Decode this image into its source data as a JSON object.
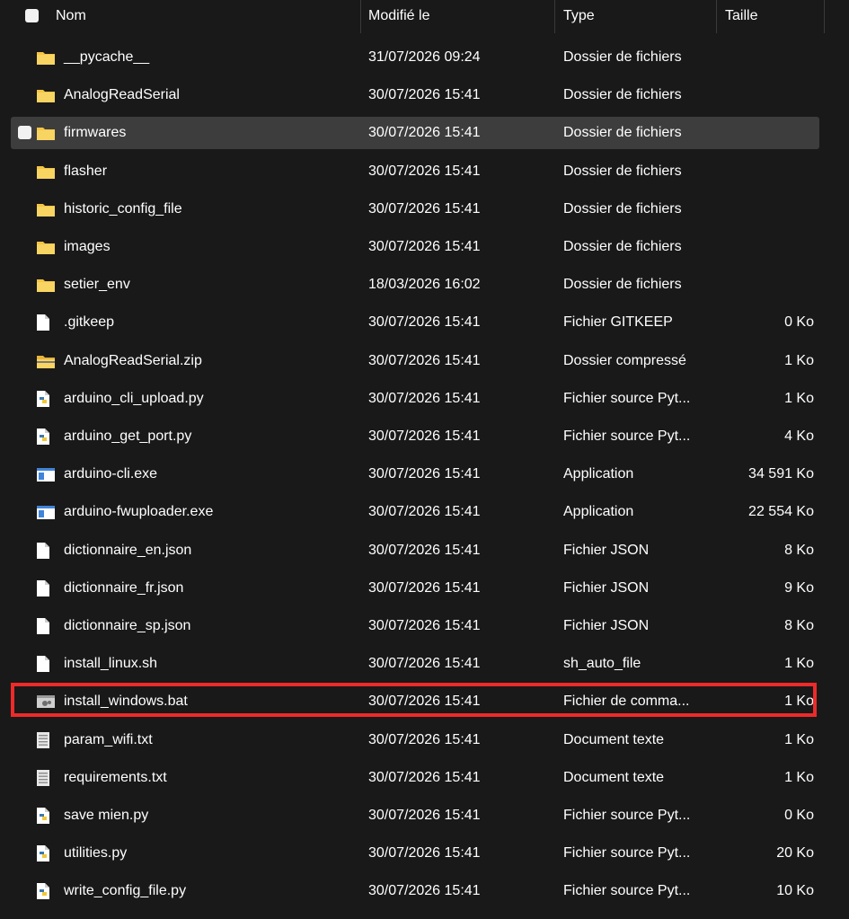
{
  "columns": {
    "name": "Nom",
    "date": "Modifié le",
    "type": "Type",
    "size": "Taille"
  },
  "files": [
    {
      "name": "__pycache__",
      "date": "31/07/2026 09:24",
      "type": "Dossier de fichiers",
      "size": "",
      "icon": "folder-icon"
    },
    {
      "name": "AnalogReadSerial",
      "date": "30/07/2026 15:41",
      "type": "Dossier de fichiers",
      "size": "",
      "icon": "folder-icon"
    },
    {
      "name": "firmwares",
      "date": "30/07/2026 15:41",
      "type": "Dossier de fichiers",
      "size": "",
      "icon": "folder-icon"
    },
    {
      "name": "flasher",
      "date": "30/07/2026 15:41",
      "type": "Dossier de fichiers",
      "size": "",
      "icon": "folder-icon"
    },
    {
      "name": "historic_config_file",
      "date": "30/07/2026 15:41",
      "type": "Dossier de fichiers",
      "size": "",
      "icon": "folder-icon"
    },
    {
      "name": "images",
      "date": "30/07/2026 15:41",
      "type": "Dossier de fichiers",
      "size": "",
      "icon": "folder-icon"
    },
    {
      "name": "setier_env",
      "date": "18/03/2026 16:02",
      "type": "Dossier de fichiers",
      "size": "",
      "icon": "folder-icon"
    },
    {
      "name": ".gitkeep",
      "date": "30/07/2026 15:41",
      "type": "Fichier GITKEEP",
      "size": "0 Ko",
      "icon": "file-icon"
    },
    {
      "name": "AnalogReadSerial.zip",
      "date": "30/07/2026 15:41",
      "type": "Dossier compressé",
      "size": "1 Ko",
      "icon": "zip-folder-icon"
    },
    {
      "name": "arduino_cli_upload.py",
      "date": "30/07/2026 15:41",
      "type": "Fichier source Pyt...",
      "size": "1 Ko",
      "icon": "python-file-icon"
    },
    {
      "name": "arduino_get_port.py",
      "date": "30/07/2026 15:41",
      "type": "Fichier source Pyt...",
      "size": "4 Ko",
      "icon": "python-file-icon"
    },
    {
      "name": "arduino-cli.exe",
      "date": "30/07/2026 15:41",
      "type": "Application",
      "size": "34 591 Ko",
      "icon": "application-icon"
    },
    {
      "name": "arduino-fwuploader.exe",
      "date": "30/07/2026 15:41",
      "type": "Application",
      "size": "22 554 Ko",
      "icon": "application-icon"
    },
    {
      "name": "dictionnaire_en.json",
      "date": "30/07/2026 15:41",
      "type": "Fichier JSON",
      "size": "8 Ko",
      "icon": "file-icon"
    },
    {
      "name": "dictionnaire_fr.json",
      "date": "30/07/2026 15:41",
      "type": "Fichier JSON",
      "size": "9 Ko",
      "icon": "file-icon"
    },
    {
      "name": "dictionnaire_sp.json",
      "date": "30/07/2026 15:41",
      "type": "Fichier JSON",
      "size": "8 Ko",
      "icon": "file-icon"
    },
    {
      "name": "install_linux.sh",
      "date": "30/07/2026 15:41",
      "type": "sh_auto_file",
      "size": "1 Ko",
      "icon": "file-icon"
    },
    {
      "name": "install_windows.bat",
      "date": "30/07/2026 15:41",
      "type": "Fichier de comma...",
      "size": "1 Ko",
      "icon": "batch-file-icon"
    },
    {
      "name": "param_wifi.txt",
      "date": "30/07/2026 15:41",
      "type": "Document texte",
      "size": "1 Ko",
      "icon": "text-file-icon"
    },
    {
      "name": "requirements.txt",
      "date": "30/07/2026 15:41",
      "type": "Document texte",
      "size": "1 Ko",
      "icon": "text-file-icon"
    },
    {
      "name": "save mien.py",
      "date": "30/07/2026 15:41",
      "type": "Fichier source Pyt...",
      "size": "0 Ko",
      "icon": "python-file-icon"
    },
    {
      "name": "utilities.py",
      "date": "30/07/2026 15:41",
      "type": "Fichier source Pyt...",
      "size": "20 Ko",
      "icon": "python-file-icon"
    },
    {
      "name": "write_config_file.py",
      "date": "30/07/2026 15:41",
      "type": "Fichier source Pyt...",
      "size": "10 Ko",
      "icon": "python-file-icon"
    }
  ],
  "hovered_row": 2,
  "highlighted_row": 17,
  "colors": {
    "background": "#191919",
    "hover_row": "#3d3d3d",
    "highlight_border": "#ee2a2a",
    "folder": "#f5c542"
  }
}
